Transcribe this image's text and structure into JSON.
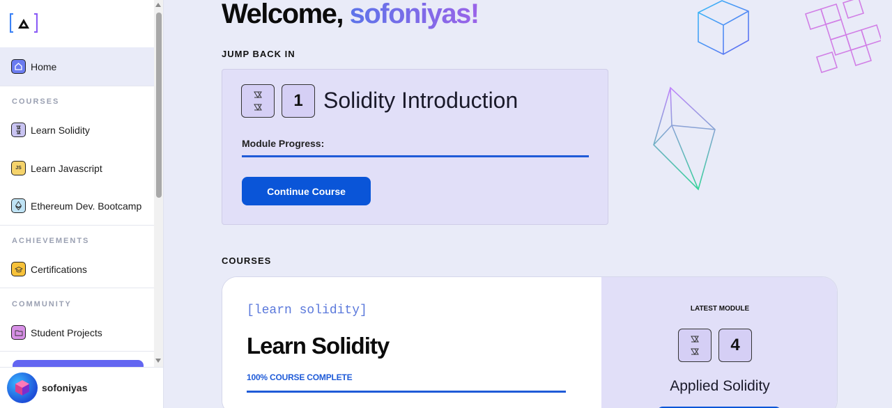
{
  "sidebar": {
    "home": {
      "label": "Home",
      "icon": "home-icon"
    },
    "sections": {
      "courses": "COURSES",
      "achievements": "ACHIEVEMENTS",
      "community": "COMMUNITY"
    },
    "courses": [
      {
        "label": "Learn Solidity",
        "icon": "solidity-icon",
        "color": "#c9c4f2"
      },
      {
        "label": "Learn Javascript",
        "icon": "javascript-icon",
        "color": "#f5d36b"
      },
      {
        "label": "Ethereum Dev. Bootcamp",
        "icon": "ethereum-icon",
        "color": "#bfe3f5"
      }
    ],
    "achievements": [
      {
        "label": "Certifications",
        "icon": "certification-icon",
        "color": "#f7c23a"
      }
    ],
    "community": [
      {
        "label": "Student Projects",
        "icon": "folder-icon",
        "color": "#d790e6"
      }
    ],
    "user": {
      "name": "sofoniyas"
    }
  },
  "main": {
    "welcome_prefix": "Welcome, ",
    "username": "sofoniyas!",
    "jump_back_label": "JUMP BACK IN",
    "jump_card": {
      "module_number": "1",
      "title": "Solidity Introduction",
      "progress_label": "Module Progress:",
      "progress": 1.0,
      "button_label": "Continue Course"
    },
    "courses_label": "COURSES",
    "course_card": {
      "tag": "[learn solidity]",
      "title": "Learn Solidity",
      "completion_text": "100% COURSE COMPLETE",
      "progress": 1.0,
      "latest_module_label": "LATEST MODULE",
      "latest_module_number": "4",
      "latest_module_title": "Applied Solidity"
    }
  },
  "colors": {
    "accent_blue": "#0a55d8",
    "card_lavender": "#e1dff8",
    "background": "#e9ebf8"
  }
}
